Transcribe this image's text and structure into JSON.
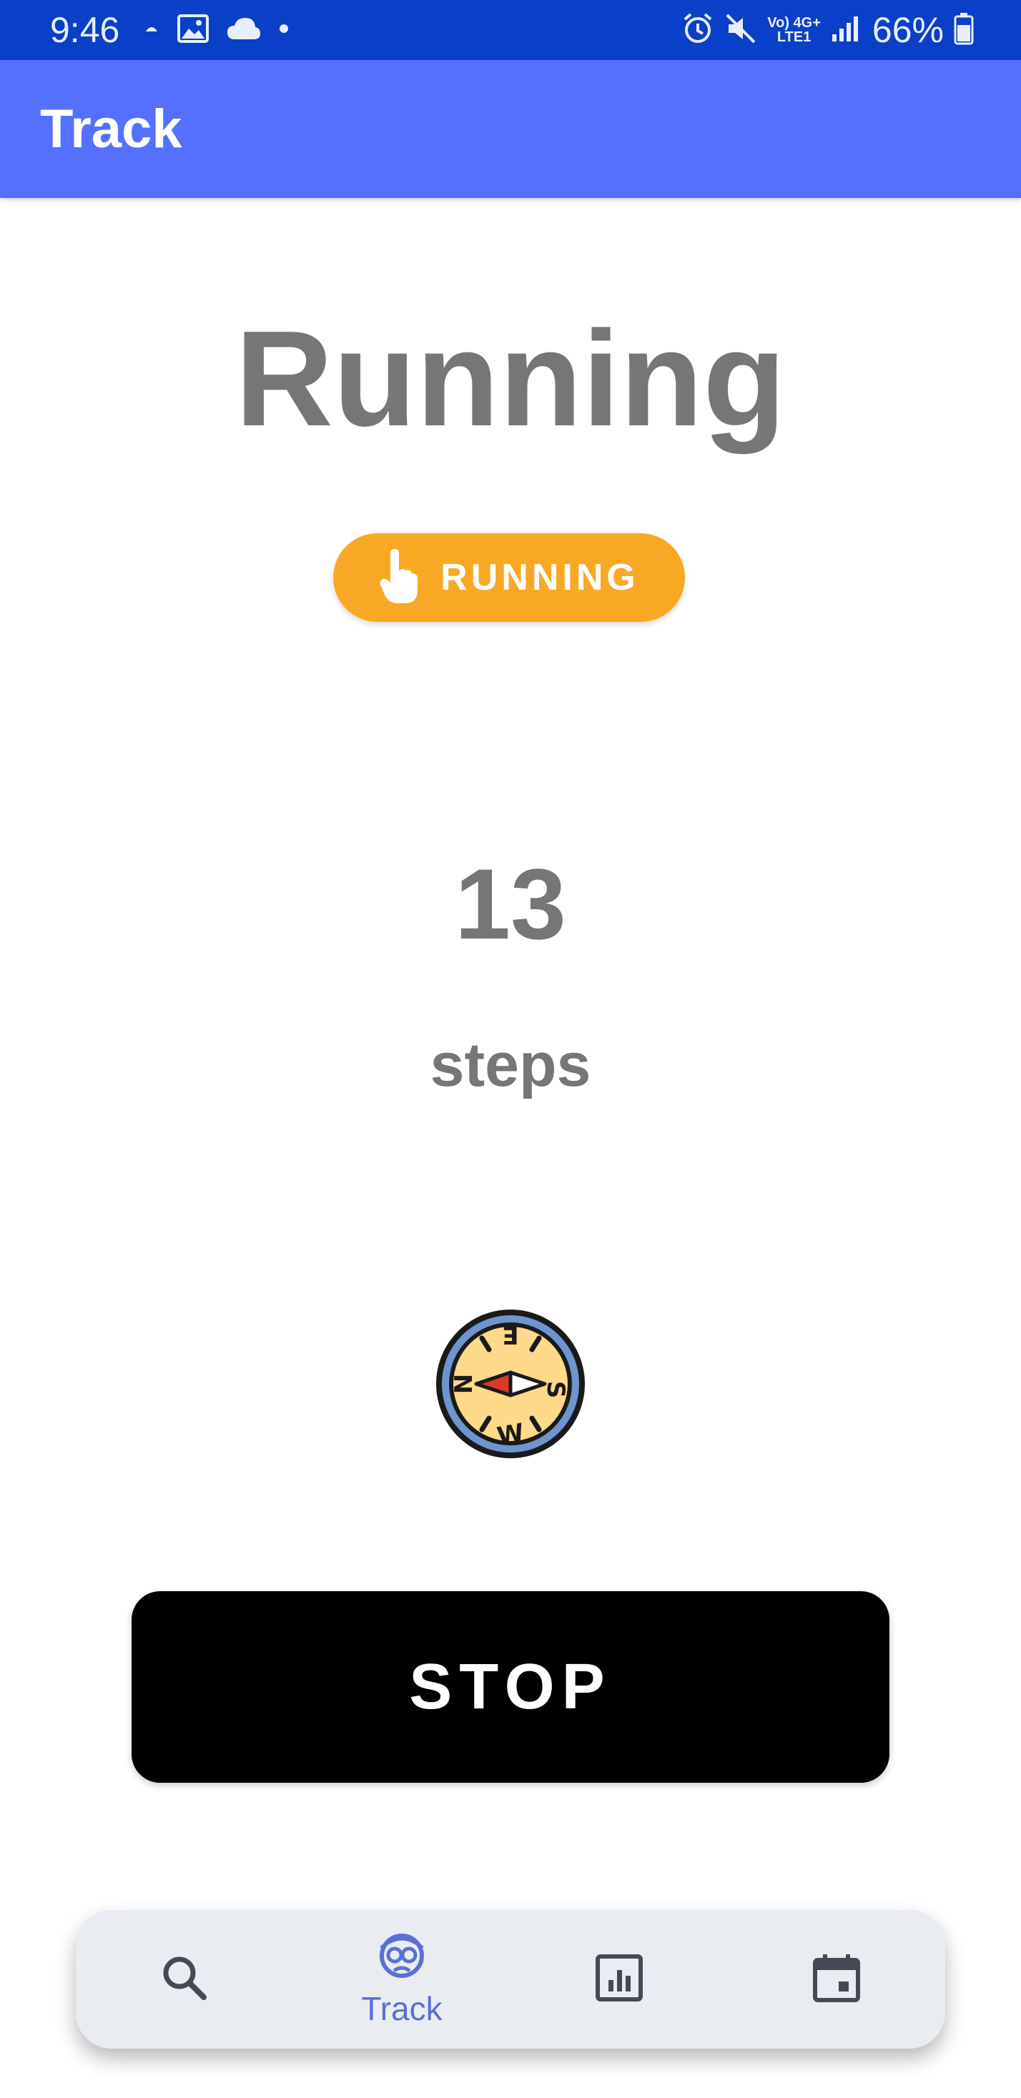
{
  "status_bar": {
    "time": "9:46",
    "network_label": "Vo) 4G+",
    "lte_label": "LTE1",
    "battery_percent": "66%",
    "left_icons": [
      "weather-icon",
      "image-icon",
      "cloud-icon",
      "dot-icon"
    ],
    "right_icons": [
      "alarm-icon",
      "mute-icon",
      "signal-icon",
      "battery-icon"
    ]
  },
  "app_bar": {
    "title": "Track"
  },
  "activity": {
    "name": "Running",
    "chip_label": "RUNNING",
    "chip_icon": "hand-pointer-icon",
    "chip_color": "#f9a825"
  },
  "steps": {
    "count": "13",
    "unit": "steps"
  },
  "compass_icon": "compass-icon",
  "stop_button": {
    "label": "STOP"
  },
  "bottom_nav": {
    "items": [
      {
        "icon": "search-icon",
        "label": "",
        "active": false
      },
      {
        "icon": "track-icon",
        "label": "Track",
        "active": true
      },
      {
        "icon": "stats-icon",
        "label": "",
        "active": false
      },
      {
        "icon": "calendar-icon",
        "label": "",
        "active": false
      }
    ],
    "active_color": "#5b6fd6"
  },
  "colors": {
    "status_bar": "#0a40c8",
    "app_bar": "#5570fe",
    "text_gray": "#767676"
  }
}
